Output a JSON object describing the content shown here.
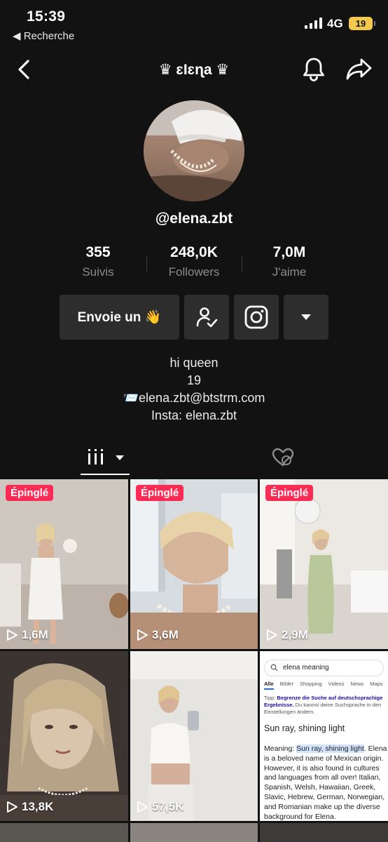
{
  "status_bar": {
    "time": "15:39",
    "back_app": "◀ Recherche",
    "network": "4G",
    "battery": "19"
  },
  "nav": {
    "title": "♛ ɛƖɛɳa ♛"
  },
  "profile": {
    "username": "@elena.zbt",
    "stats": [
      {
        "value": "355",
        "label": "Suivis"
      },
      {
        "value": "248,0K",
        "label": "Followers"
      },
      {
        "value": "7,0M",
        "label": "J'aime"
      }
    ],
    "message_button": "Envoie un 👋",
    "bio": [
      "hi queen",
      "19",
      "📨elena.zbt@btstrm.com",
      "Insta: elena.zbt"
    ]
  },
  "videos": [
    {
      "pinned": true,
      "pin_label": "Épinglé",
      "views": "1,6M"
    },
    {
      "pinned": true,
      "pin_label": "Épinglé",
      "views": "3,6M"
    },
    {
      "pinned": true,
      "pin_label": "Épinglé",
      "views": "2,9M"
    },
    {
      "pinned": false,
      "views": "13,8K"
    },
    {
      "pinned": false,
      "views": "57,5K"
    },
    {
      "pinned": false,
      "views": "",
      "search_screenshot": {
        "query": "elena meaning",
        "tabs": [
          "Alle",
          "Bilder",
          "Shopping",
          "Videos",
          "News",
          "Maps"
        ],
        "tip_prefix": "Tipp: ",
        "tip_link": "Begrenze die Suche auf deutschsprachige Ergebnisse.",
        "tip_rest": " Du kannst deine Suchsprache in den Einstellungen ändern.",
        "headline": "Sun ray, shining light",
        "meaning_prefix": "Meaning: ",
        "meaning_highlight": "Sun ray, shining light",
        "meaning_body": ". Elena is a beloved name of Mexican origin. However, it is also found in cultures and languages from all over! Italian, Spanish, Welsh, Hawaiian, Greek, Slavic, Hebrew, German, Norwegian, and Romanian make up the diverse background for Elena."
      }
    }
  ],
  "colors": {
    "background": "#121212",
    "button_bg": "#2d2d2d",
    "pinned_badge": "#fe2c55",
    "muted_text": "#8c8c8c"
  }
}
